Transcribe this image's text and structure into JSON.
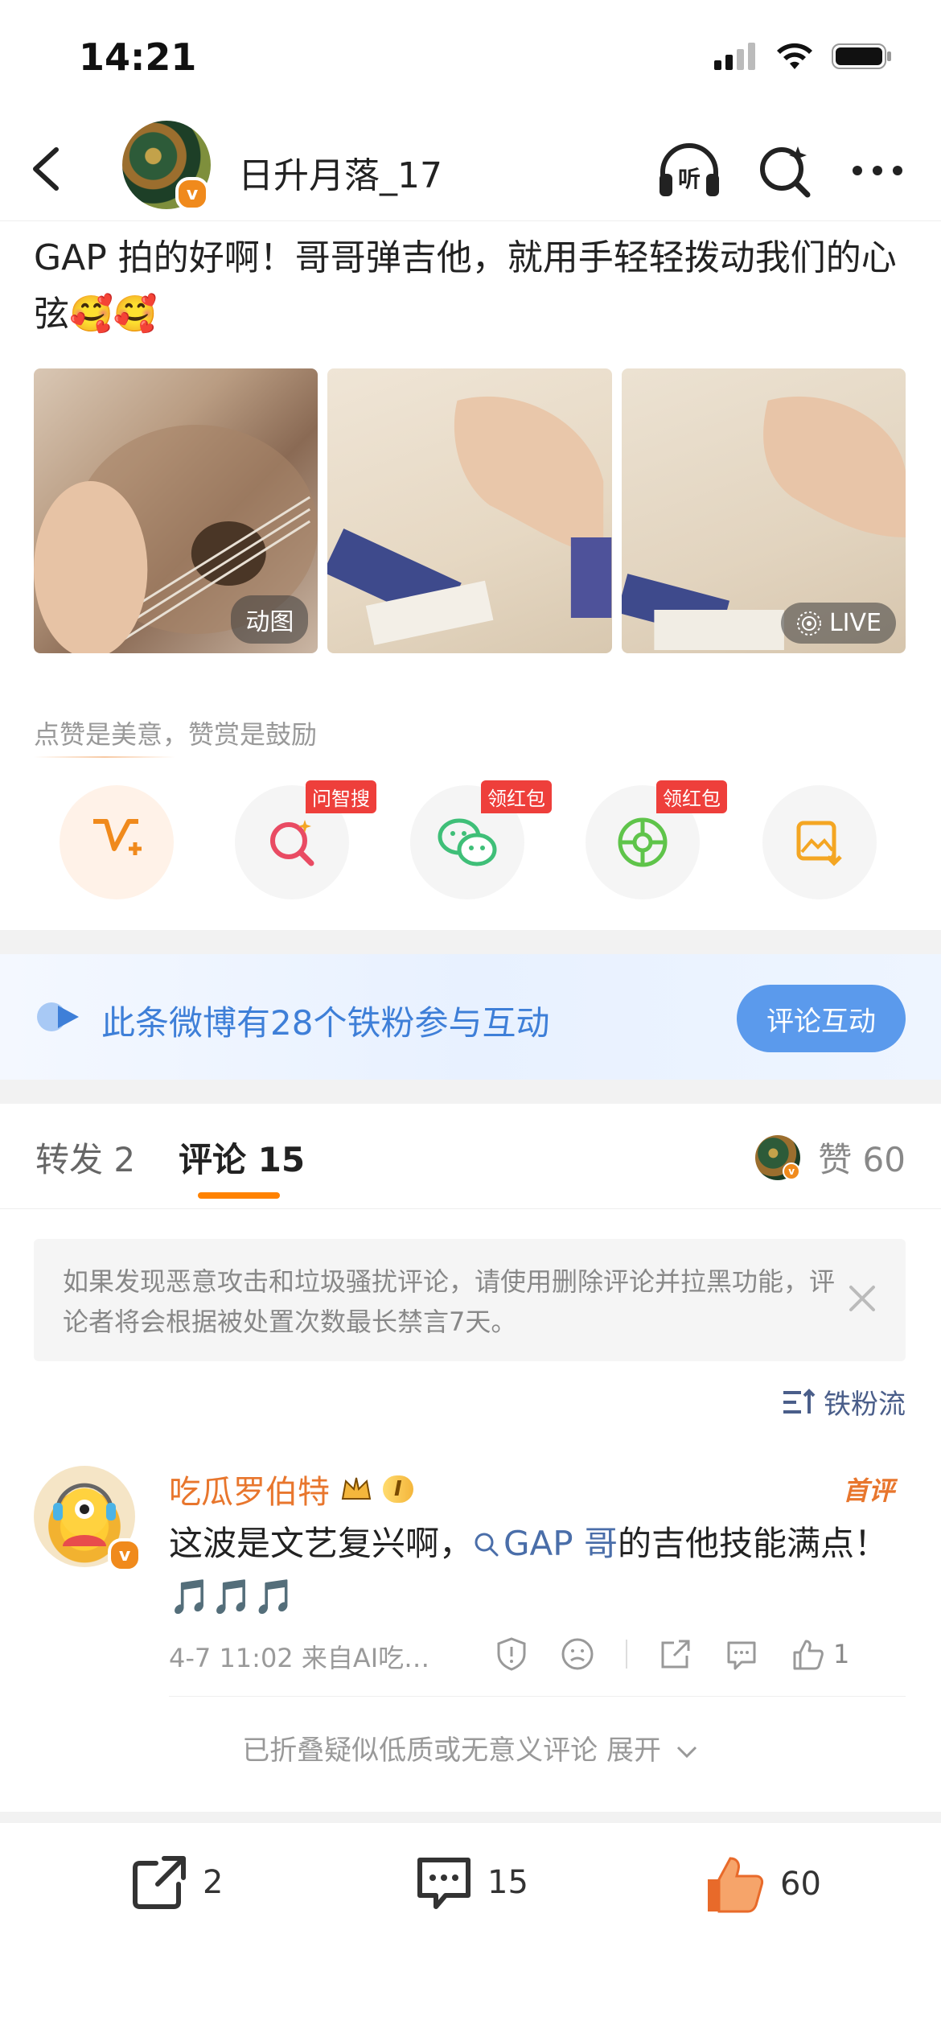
{
  "status": {
    "time": "14:21"
  },
  "nav": {
    "username": "日升月落_17",
    "v_badge": "v"
  },
  "post": {
    "text": "GAP 拍的好啊！哥哥弹吉他，就用手轻轻拨动我们的心弦🥰🥰",
    "images": [
      {
        "badge": "动图"
      },
      {
        "badge": ""
      },
      {
        "badge": "LIVE"
      }
    ]
  },
  "reward": {
    "hint": "点赞是美意，赞赏是鼓励",
    "items": [
      {
        "icon": "reward-v-icon",
        "tag": ""
      },
      {
        "icon": "ai-search-icon",
        "tag": "问智搜"
      },
      {
        "icon": "wechat-icon",
        "tag": "领红包"
      },
      {
        "icon": "moments-icon",
        "tag": "领红包"
      },
      {
        "icon": "save-image-icon",
        "tag": ""
      }
    ]
  },
  "fan_banner": {
    "text": "此条微博有28个铁粉参与互动",
    "button": "评论互动"
  },
  "tabs": {
    "repost": "转发 2",
    "comment": "评论 15",
    "like": "赞 60"
  },
  "notice": {
    "text": "如果发现恶意攻击和垃圾骚扰评论，请使用删除评论并拉黑功能，评论者将会根据被处置次数最长禁言7天。"
  },
  "sort": {
    "label": "铁粉流"
  },
  "comment": {
    "name": "吃瓜罗伯特",
    "vip_label": "I",
    "first_tag": "首评",
    "text_before": "这波是文艺复兴啊，",
    "link": "GAP 哥",
    "text_after": "的吉他技能满点！🎵🎵🎵",
    "meta": "4-7 11:02 来自AI吃…",
    "like_count": "1"
  },
  "folded": {
    "text": "已折叠疑似低质或无意义评论 展开"
  },
  "bottom_bar": {
    "repost": "2",
    "comment": "15",
    "like": "60"
  },
  "colors": {
    "accent": "#ff8200",
    "link": "#4a6ea9",
    "banner_text": "#3e7fd8",
    "red_tag": "#ee3f3b"
  }
}
